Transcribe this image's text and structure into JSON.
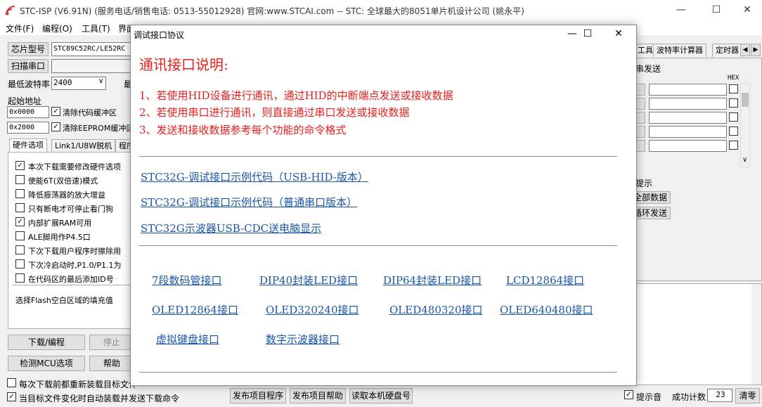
{
  "window": {
    "title": "STC-ISP (V6.91N) (服务电话/销售电话: 0513-55012928) 官网:www.STCAI.com  -- STC: 全球最大的8051单片机设计公司 (姚永平)"
  },
  "menu": [
    "文件(F)",
    "编程(O)",
    "工具(T)",
    "界面"
  ],
  "left": {
    "chip_model_btn": "芯片型号",
    "chip_model_value": "STC89C52RC/LE52RC",
    "scan_port_btn": "扫描串口",
    "min_baud_label": "最低波特率",
    "min_baud_value": "2400",
    "max_label_partial": "最",
    "start_addr_label": "起始地址",
    "addr1": "0x0000",
    "clear_code_label": "清除代码缓冲区",
    "addr2": "0x2000",
    "clear_eeprom_label": "清除EEPROM缓冲区",
    "tabs": [
      "硬件选项",
      "Link1/U8W脱机",
      "程序"
    ],
    "options": [
      {
        "label": "本次下载需要修改硬件选项",
        "checked": true
      },
      {
        "label": "使能6T(双倍速)模式",
        "checked": false
      },
      {
        "label": "降低振荡器的放大增益",
        "checked": false
      },
      {
        "label": "只有断电才可停止看门狗",
        "checked": false
      },
      {
        "label": "内部扩展RAM可用",
        "checked": true
      },
      {
        "label": "ALE脚用作P4.5口",
        "checked": false
      },
      {
        "label": "下次下载用户程序时擦除用",
        "checked": false
      },
      {
        "label": "下次冷启动时,P1.0/P1.1为",
        "checked": false
      },
      {
        "label": "在代码区的最后添加ID号",
        "checked": false
      }
    ],
    "fill_label": "选择Flash空白区域的填充值",
    "download_btn": "下载/编程",
    "stop_btn": "停止",
    "detect_btn": "检测MCU选项",
    "help_btn": "帮助",
    "reload_label": "每次下载前都重新装载目标文件",
    "auto_label": "当目标文件变化时自动装载并发送下载命令"
  },
  "bottom": {
    "publish_btn": "发布项目程序",
    "publish_help_btn": "发布项目帮助",
    "read_disk_btn": "读取本机硬盘号",
    "sound_label": "提示音",
    "success_label": "成功计数",
    "success_value": "23",
    "clear_btn": "清零"
  },
  "right": {
    "tabs": [
      "工具",
      "波特率计算器",
      "定时器"
    ],
    "multi_send_label": "串发送",
    "hex_label": "HEX",
    "hint_label": "提示",
    "all_data_btn": "全部数据",
    "loop_send_btn": "循环发送"
  },
  "dialog": {
    "title": "调试接口协议",
    "heading": "通讯接口说明:",
    "lines": [
      "1、若使用HID设备进行通讯，通过HID的中断端点发送或接收数据",
      "2、若使用串口进行通讯，则直接通过串口发送或接收数据",
      "3、发送和接收数据参考每个功能的命令格式"
    ],
    "links": [
      "STC32G-调试接口示例代码（USB-HID-版本）",
      "STC32G-调试接口示例代码（普通串口版本）",
      "STC32G示波器USB-CDC送电脑显示"
    ],
    "grid_links": [
      [
        "7段数码管接口",
        "DIP40封装LED接口",
        "DIP64封装LED接口",
        "LCD12864接口"
      ],
      [
        "OLED12864接口",
        "OLED320240接口",
        "OLED480320接口",
        "OLED640480接口"
      ],
      [
        "虚拟键盘接口",
        "数字示波器接口"
      ]
    ]
  }
}
